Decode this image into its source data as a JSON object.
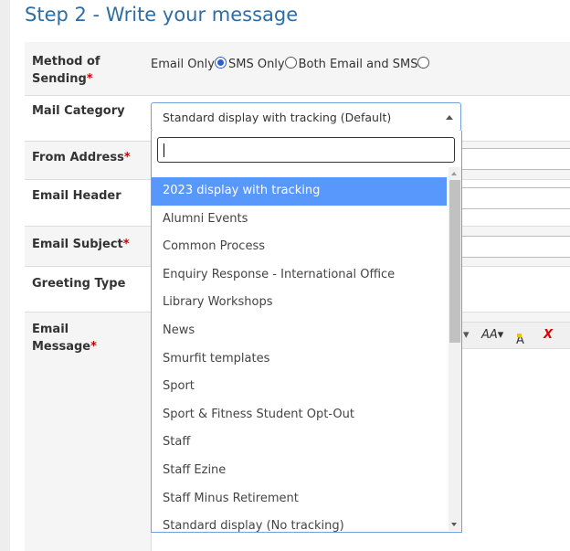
{
  "step": {
    "title": "Step 2 - Write your message"
  },
  "form": {
    "method_label": "Method of Sending",
    "method_options": [
      "Email Only",
      "SMS Only",
      "Both Email and SMS"
    ],
    "method_selected": "Email Only",
    "mail_category_label": "Mail Category",
    "mail_category_value": "Standard display with tracking (Default)",
    "from_address_label": "From Address",
    "email_header_label": "Email Header",
    "email_subject_label": "Email Subject",
    "greeting_type_label": "Greeting Type",
    "email_message_label": "Email Message",
    "required_marker": "*"
  },
  "editor_toolbar": {
    "font_size_icon": "AA▾",
    "font_color_icon": "A",
    "remove_format_icon": "X"
  },
  "dropdown": {
    "search_value": "",
    "highlighted": "2023 display with tracking",
    "items": [
      "2023 display with tracking",
      "Alumni Events",
      "Common Process",
      "Enquiry Response - International Office",
      "Library Workshops",
      "News",
      "Smurfit templates",
      "Sport",
      "Sport & Fitness Student Opt-Out",
      "Staff",
      "Staff Ezine",
      "Staff Minus Retirement",
      "Standard display (No tracking)"
    ]
  },
  "colors": {
    "title": "#2e6da4",
    "highlight": "#5897fb",
    "required": "#cc0000",
    "remove_format": "#dd0000"
  }
}
